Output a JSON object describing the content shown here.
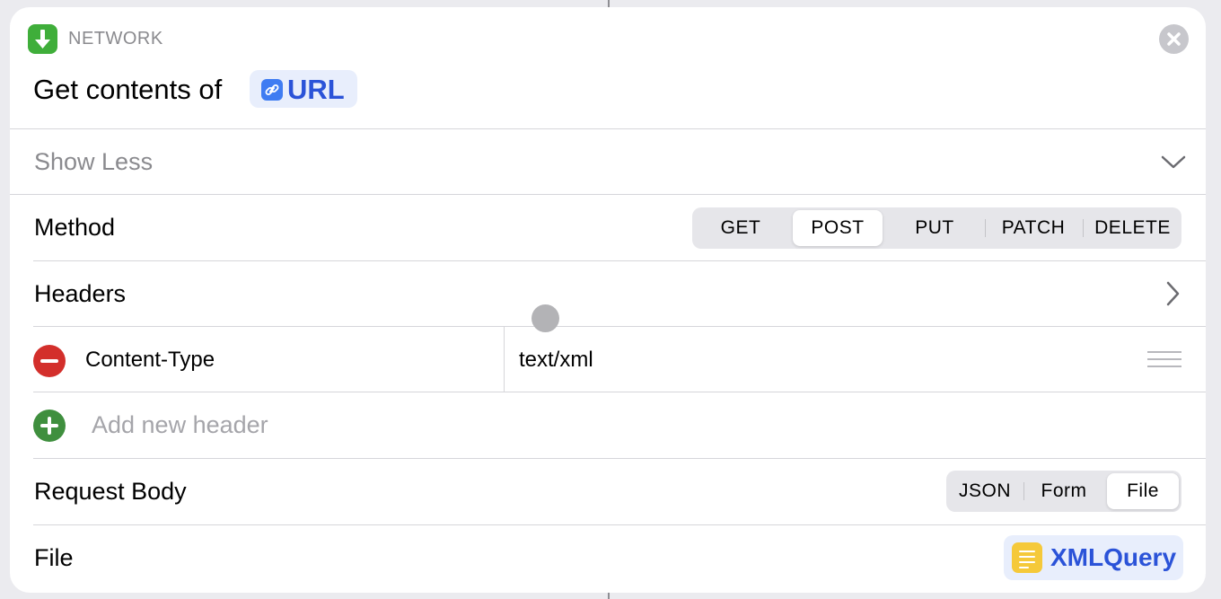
{
  "action": {
    "category": "NETWORK",
    "title": "Get contents of",
    "url_token": "URL"
  },
  "show_less": "Show Less",
  "method": {
    "label": "Method",
    "options": [
      "GET",
      "POST",
      "PUT",
      "PATCH",
      "DELETE"
    ],
    "selected": "POST"
  },
  "headers": {
    "label": "Headers",
    "items": [
      {
        "key": "Content-Type",
        "value": "text/xml"
      }
    ],
    "add_placeholder": "Add new header"
  },
  "request_body": {
    "label": "Request Body",
    "options": [
      "JSON",
      "Form",
      "File"
    ],
    "selected": "File"
  },
  "file": {
    "label": "File",
    "token": "XMLQuery"
  },
  "colors": {
    "accent_blue": "#2b53d8",
    "network_green": "#3fae3a",
    "delete_red": "#d32f2b",
    "add_green": "#3f8f3e",
    "doc_yellow": "#f5c93a"
  },
  "icons": [
    "download-arrow-icon",
    "close-icon",
    "link-icon",
    "chevron-down-icon",
    "chevron-right-icon",
    "minus-circle-icon",
    "plus-circle-icon",
    "drag-handle-icon",
    "document-icon"
  ]
}
